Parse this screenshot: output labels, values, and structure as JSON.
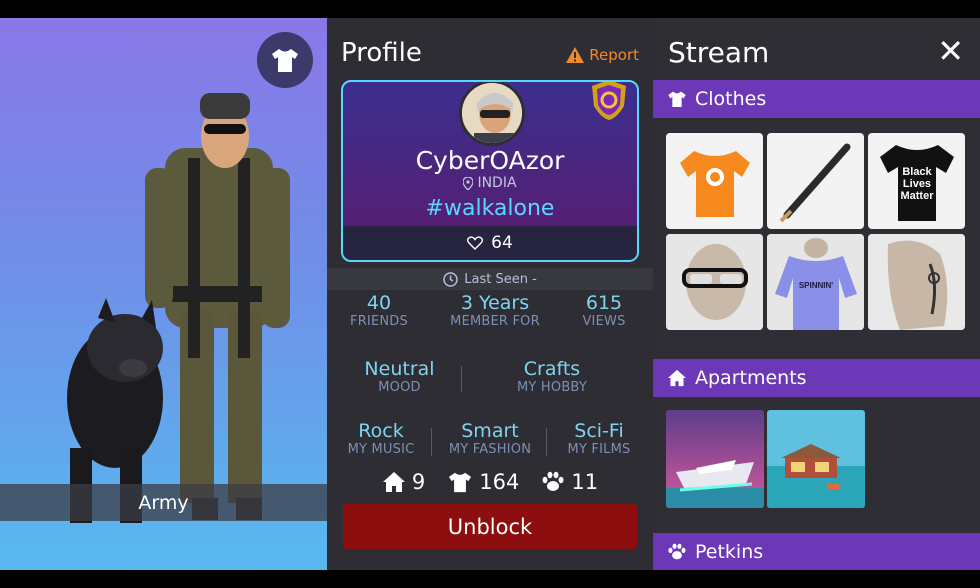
{
  "avatar": {
    "outfit_name": "Army",
    "outfit_icon": "tshirt-icon"
  },
  "profile": {
    "title": "Profile",
    "report_label": "Report",
    "username": "CyberOAzor",
    "location": "INDIA",
    "hashtag": "#walkalone",
    "likes": "64",
    "last_seen": "Last Seen -",
    "stats": [
      {
        "value": "40",
        "label": "FRIENDS"
      },
      {
        "value": "3 Years",
        "label": "MEMBER FOR"
      },
      {
        "value": "615",
        "label": "VIEWS"
      }
    ],
    "mood": {
      "value": "Neutral",
      "label": "MOOD"
    },
    "hobby": {
      "value": "Crafts",
      "label": "MY HOBBY"
    },
    "music": {
      "value": "Rock",
      "label": "MY MUSIC"
    },
    "fashion": {
      "value": "Smart",
      "label": "MY FASHION"
    },
    "films": {
      "value": "Sci-Fi",
      "label": "MY FILMS"
    },
    "counts": {
      "apartments": "9",
      "clothes": "164",
      "pets": "11"
    },
    "unblock_label": "Unblock"
  },
  "stream": {
    "title": "Stream",
    "close_label": "✕",
    "sections": {
      "clothes": "Clothes",
      "apartments": "Apartments",
      "petkins": "Petkins"
    },
    "tshirt_text": "Black\nLives\nMatter",
    "tshirt_line1": "Black",
    "tshirt_line2": "Lives",
    "tshirt_line3": "Matter",
    "shirt_logo": "SPINNIN'"
  },
  "colors": {
    "accent_purple": "#6c38b7",
    "accent_cyan": "#5ad7ff",
    "unblock_red": "#8c0e0e",
    "report_orange": "#f08a2a"
  }
}
